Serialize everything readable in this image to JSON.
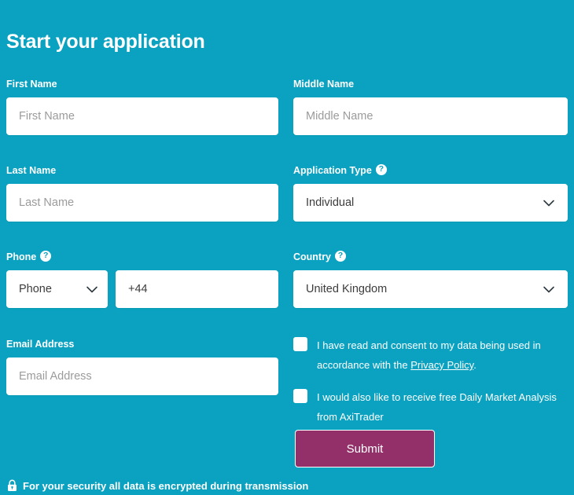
{
  "page": {
    "title": "Start your application",
    "background_color": "#0aa2c0",
    "accent_color": "#93306a"
  },
  "fields": {
    "first_name": {
      "label": "First Name",
      "placeholder": "First Name",
      "value": ""
    },
    "middle_name": {
      "label": "Middle Name",
      "placeholder": "Middle Name",
      "value": ""
    },
    "last_name": {
      "label": "Last Name",
      "placeholder": "Last Name",
      "value": ""
    },
    "application_type": {
      "label": "Application Type",
      "help": "?",
      "value": "Individual",
      "icon": "chevron-down-icon"
    },
    "phone": {
      "label": "Phone",
      "help": "?",
      "type_value": "Phone",
      "type_icon": "chevron-down-icon",
      "prefix_value": "+44"
    },
    "country": {
      "label": "Country",
      "help": "?",
      "value": "United Kingdom",
      "icon": "chevron-down-icon"
    },
    "email": {
      "label": "Email Address",
      "placeholder": "Email Address",
      "value": ""
    }
  },
  "consents": [
    {
      "text_before": "I have read and consent to my data being used in accordance with the ",
      "link_text": "Privacy Policy",
      "text_after": ".",
      "checked": false
    },
    {
      "text_before": "I would also like to receive free Daily Market Analysis from AxiTrader",
      "link_text": "",
      "text_after": "",
      "checked": false
    }
  ],
  "submit": {
    "label": "Submit"
  },
  "footer": {
    "icon": "lock-icon",
    "text": "For your security all data is encrypted during transmission"
  }
}
